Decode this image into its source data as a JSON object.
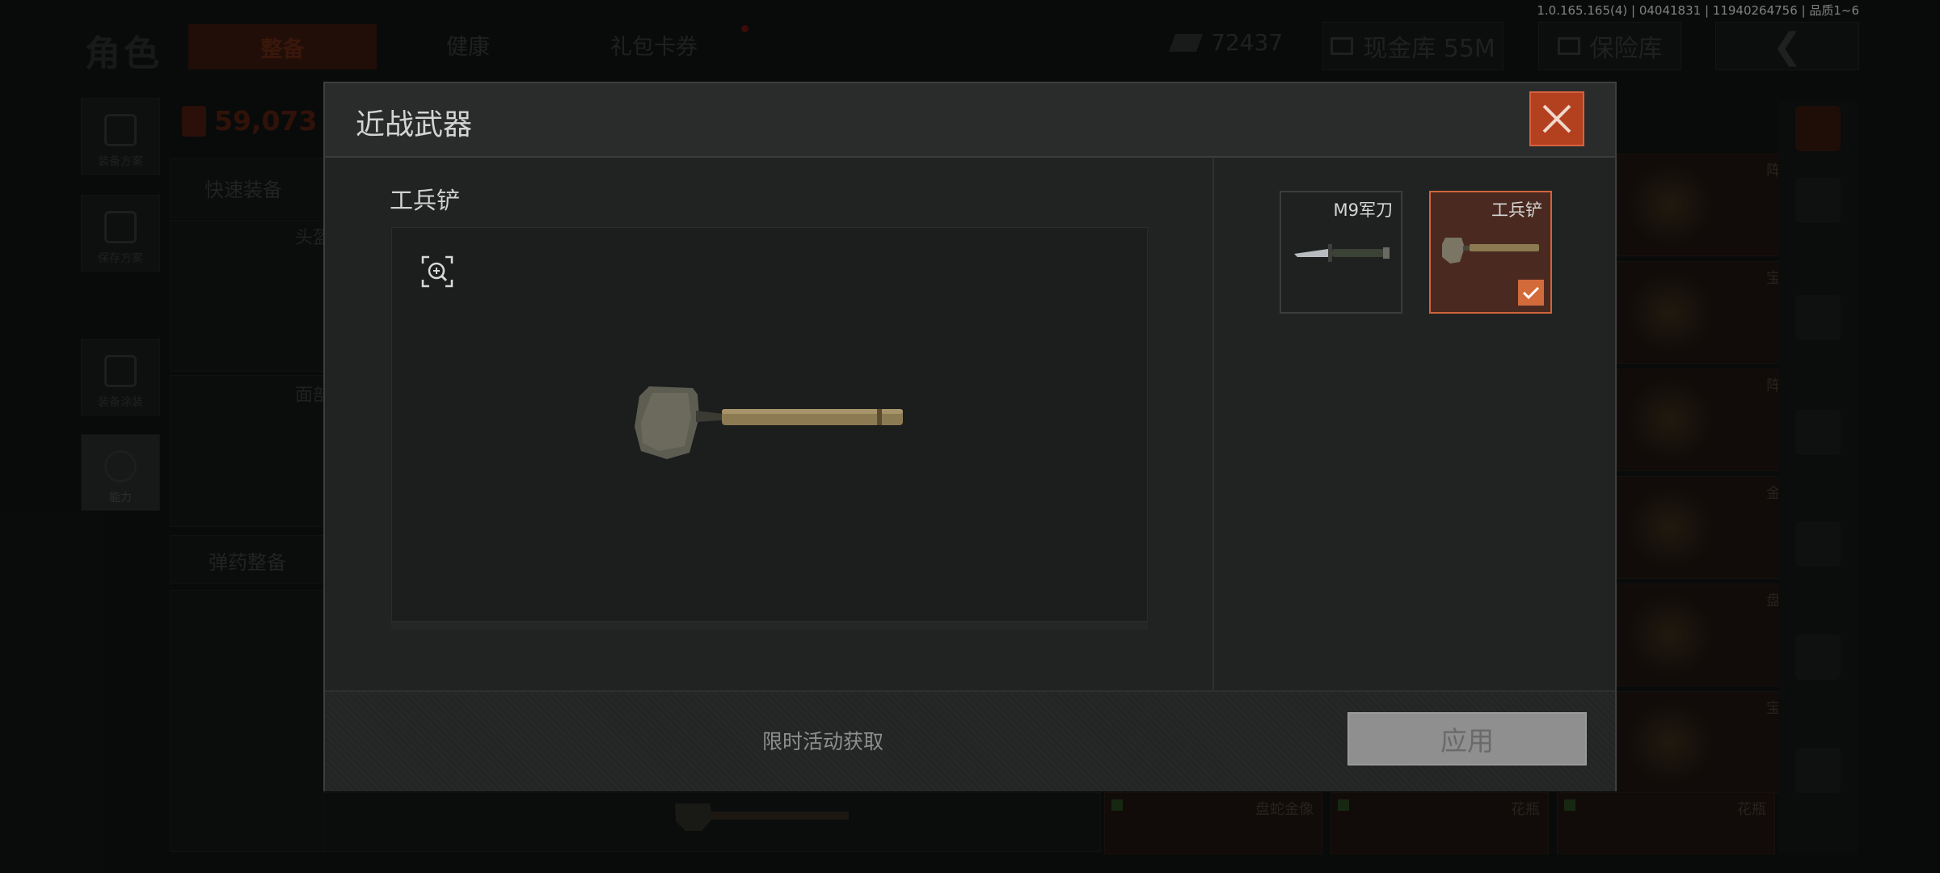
{
  "version": "1.0.165.165(4) | 04041831 | 11940264756 | 品质1~6",
  "background": {
    "role_title": "角色",
    "tabs": [
      "整备",
      "健康",
      "礼包卡券"
    ],
    "currency": "72437",
    "cash_vault": "现金库 55M",
    "safe_vault": "保险库",
    "side_menu": [
      "装备方案",
      "保存方案",
      "装备涂装",
      "能力"
    ],
    "weight": "59,073",
    "quick_equip": "快速装备",
    "ammo_equip": "弹药整备",
    "slot_labels": [
      "头盔",
      "面部"
    ],
    "loot": [
      "阵列镜片",
      "宝石项链",
      "阵列镜片",
      "金狮雕像",
      "盘蛇金像",
      "宝石项链"
    ],
    "bottom_loot": [
      "盘蛇金像",
      "花瓶",
      "花瓶"
    ]
  },
  "modal": {
    "title": "近战武器",
    "item_name": "工兵铲",
    "acquire_text": "限时活动获取",
    "apply_label": "应用",
    "thumbs": [
      {
        "label": "M9军刀",
        "selected": false
      },
      {
        "label": "工兵铲",
        "selected": true
      }
    ]
  },
  "colors": {
    "accent": "#d36a3a",
    "close": "#b3401f",
    "apply": "#8f8f8f"
  }
}
